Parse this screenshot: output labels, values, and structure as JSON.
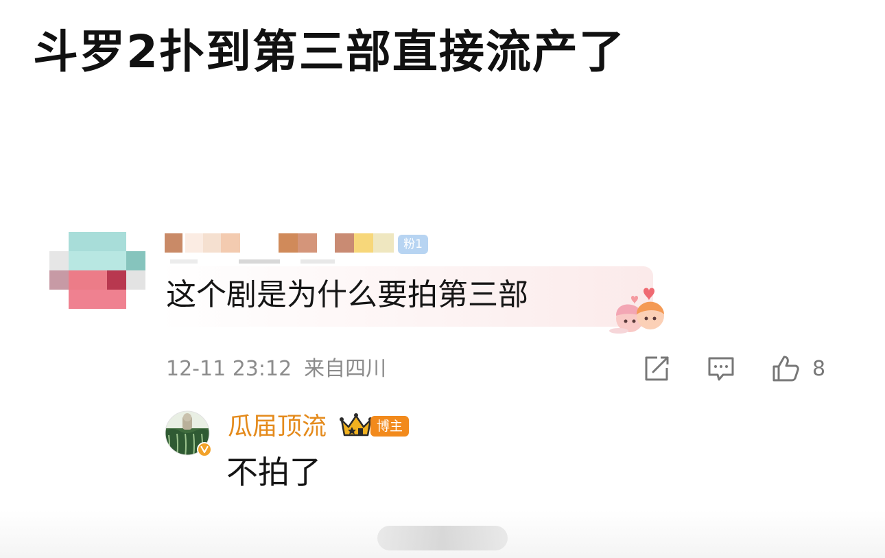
{
  "post": {
    "title": "斗罗2扑到第三部直接流产了"
  },
  "comment": {
    "badge": "粉1",
    "text": "这个剧是为什么要拍第三部",
    "timestamp": "12-11 23:12",
    "location": "来自四川",
    "like_count": "8",
    "icons": {
      "share": "share-icon",
      "reply": "comment-icon",
      "like": "thumbs-up-icon",
      "sticker": "couple-hearts-sticker-icon"
    }
  },
  "reply": {
    "username": "瓜届顶流",
    "badge": "博主",
    "text": "不拍了",
    "icons": {
      "crown": "crown-icon",
      "verified": "verified-v-icon"
    }
  },
  "colors": {
    "title": "#111111",
    "meta": "#8c8c8c",
    "reply_name": "#e48a1b",
    "blogger_badge": "#f28a1c",
    "fan_badge": "#b7d4f2"
  }
}
